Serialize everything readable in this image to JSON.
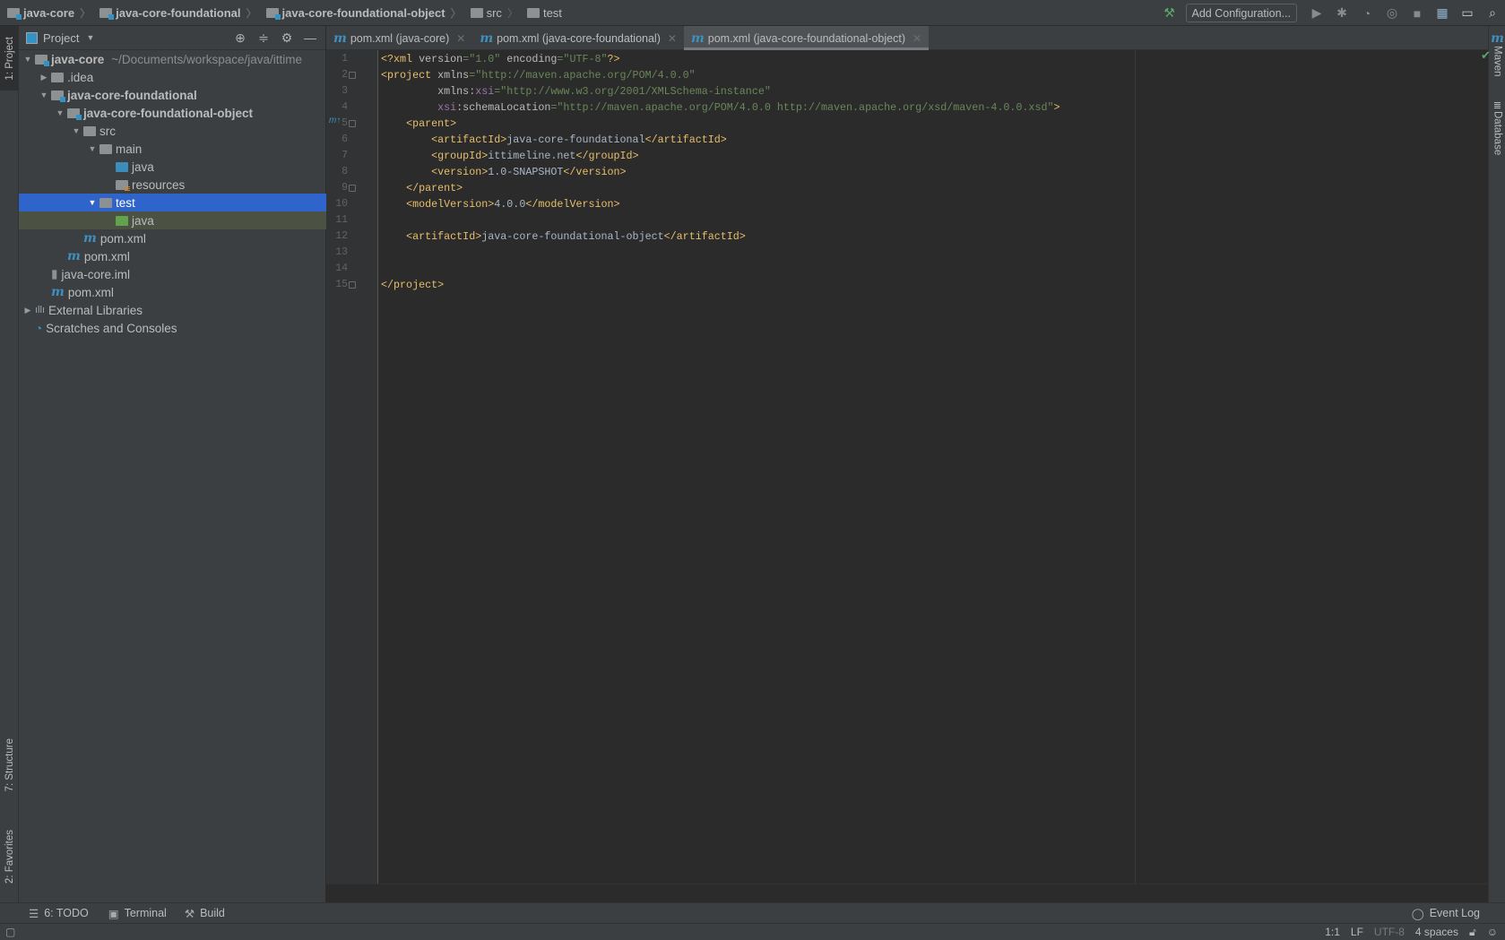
{
  "breadcrumbs": [
    {
      "label": "java-core",
      "icon": "module-folder-icon"
    },
    {
      "label": "java-core-foundational",
      "icon": "module-folder-icon"
    },
    {
      "label": "java-core-foundational-object",
      "icon": "module-folder-icon"
    },
    {
      "label": "src",
      "icon": "folder-icon"
    },
    {
      "label": "test",
      "icon": "folder-icon"
    }
  ],
  "toolbar": {
    "add_configuration": "Add Configuration..."
  },
  "left_stripe": {
    "project": "1: Project",
    "structure": "7: Structure",
    "favorites": "2: Favorites"
  },
  "right_stripe": {
    "maven": "Maven",
    "database": "Database"
  },
  "project_panel": {
    "title": "Project",
    "tree": [
      {
        "label": "java-core",
        "hint": "~/Documents/workspace/java/ittime",
        "level": 0,
        "arrow": "down",
        "icon": "module",
        "bold": true
      },
      {
        "label": ".idea",
        "level": 1,
        "arrow": "right",
        "icon": "folder"
      },
      {
        "label": "java-core-foundational",
        "level": 1,
        "arrow": "down",
        "icon": "module",
        "bold": true
      },
      {
        "label": "java-core-foundational-object",
        "level": 2,
        "arrow": "down",
        "icon": "module",
        "bold": true
      },
      {
        "label": "src",
        "level": 3,
        "arrow": "down",
        "icon": "folder"
      },
      {
        "label": "main",
        "level": 4,
        "arrow": "down",
        "icon": "folder"
      },
      {
        "label": "java",
        "level": 5,
        "icon": "source-folder"
      },
      {
        "label": "resources",
        "level": 5,
        "icon": "resources-folder"
      },
      {
        "label": "test",
        "level": 4,
        "arrow": "down",
        "icon": "folder",
        "selected": true
      },
      {
        "label": "java",
        "level": 5,
        "icon": "test-folder",
        "highlight": true
      },
      {
        "label": "pom.xml",
        "level": 3,
        "icon": "maven"
      },
      {
        "label": "pom.xml",
        "level": 2,
        "icon": "maven"
      },
      {
        "label": "java-core.iml",
        "level": 1,
        "icon": "iml"
      },
      {
        "label": "pom.xml",
        "level": 1,
        "icon": "maven"
      },
      {
        "label": "External Libraries",
        "level": 0,
        "arrow": "right",
        "icon": "libraries"
      },
      {
        "label": "Scratches and Consoles",
        "level": 0,
        "icon": "scratches"
      }
    ]
  },
  "tabs": [
    {
      "label": "pom.xml (java-core)",
      "active": false
    },
    {
      "label": "pom.xml (java-core-foundational)",
      "active": false
    },
    {
      "label": "pom.xml (java-core-foundational-object)",
      "active": true
    }
  ],
  "editor": {
    "lines": [
      [
        [
          "tag",
          "<?xml "
        ],
        [
          "attr",
          "version"
        ],
        [
          "str",
          "=\"1.0\""
        ],
        [
          "attr",
          " encoding"
        ],
        [
          "str",
          "=\"UTF-8\""
        ],
        [
          "tag",
          "?>"
        ]
      ],
      [
        [
          "tag",
          "<project "
        ],
        [
          "attr",
          "xmlns"
        ],
        [
          "str",
          "=\"http://maven.apache.org/POM/4.0.0\""
        ]
      ],
      [
        [
          "text",
          "         "
        ],
        [
          "attr",
          "xmlns:"
        ],
        [
          "ns",
          "xsi"
        ],
        [
          "str",
          "=\"http://www.w3.org/2001/XMLSchema-instance\""
        ]
      ],
      [
        [
          "text",
          "         "
        ],
        [
          "ns",
          "xsi"
        ],
        [
          "attr",
          ":schemaLocation"
        ],
        [
          "str",
          "=\"http://maven.apache.org/POM/4.0.0 http://maven.apache.org/xsd/maven-4.0.0.xsd\""
        ],
        [
          "tag",
          ">"
        ]
      ],
      [
        [
          "text",
          "    "
        ],
        [
          "tag",
          "<parent>"
        ]
      ],
      [
        [
          "text",
          "        "
        ],
        [
          "tag",
          "<artifactId>"
        ],
        [
          "text",
          "java-core-foundational"
        ],
        [
          "tag",
          "</artifactId>"
        ]
      ],
      [
        [
          "text",
          "        "
        ],
        [
          "tag",
          "<groupId>"
        ],
        [
          "text",
          "ittimeline.net"
        ],
        [
          "tag",
          "</groupId>"
        ]
      ],
      [
        [
          "text",
          "        "
        ],
        [
          "tag",
          "<version>"
        ],
        [
          "text",
          "1.0-SNAPSHOT"
        ],
        [
          "tag",
          "</version>"
        ]
      ],
      [
        [
          "text",
          "    "
        ],
        [
          "tag",
          "</parent>"
        ]
      ],
      [
        [
          "text",
          "    "
        ],
        [
          "tag",
          "<modelVersion>"
        ],
        [
          "text",
          "4.0.0"
        ],
        [
          "tag",
          "</modelVersion>"
        ]
      ],
      [],
      [
        [
          "text",
          "    "
        ],
        [
          "tag",
          "<artifactId>"
        ],
        [
          "text",
          "java-core-foundational-object"
        ],
        [
          "tag",
          "</artifactId>"
        ]
      ],
      [],
      [],
      [
        [
          "tag",
          "</project>"
        ]
      ]
    ]
  },
  "bottom_tools": {
    "todo": "6: TODO",
    "terminal": "Terminal",
    "build": "Build",
    "event_log": "Event Log"
  },
  "status": {
    "position": "1:1",
    "line_sep": "LF",
    "encoding": "UTF-8",
    "indent": "4 spaces"
  },
  "colors": {
    "tag": "#e8bf6a",
    "attr": "#bababa",
    "string": "#6a8759",
    "namespace": "#9876aa",
    "selection": "#2f65ca"
  }
}
